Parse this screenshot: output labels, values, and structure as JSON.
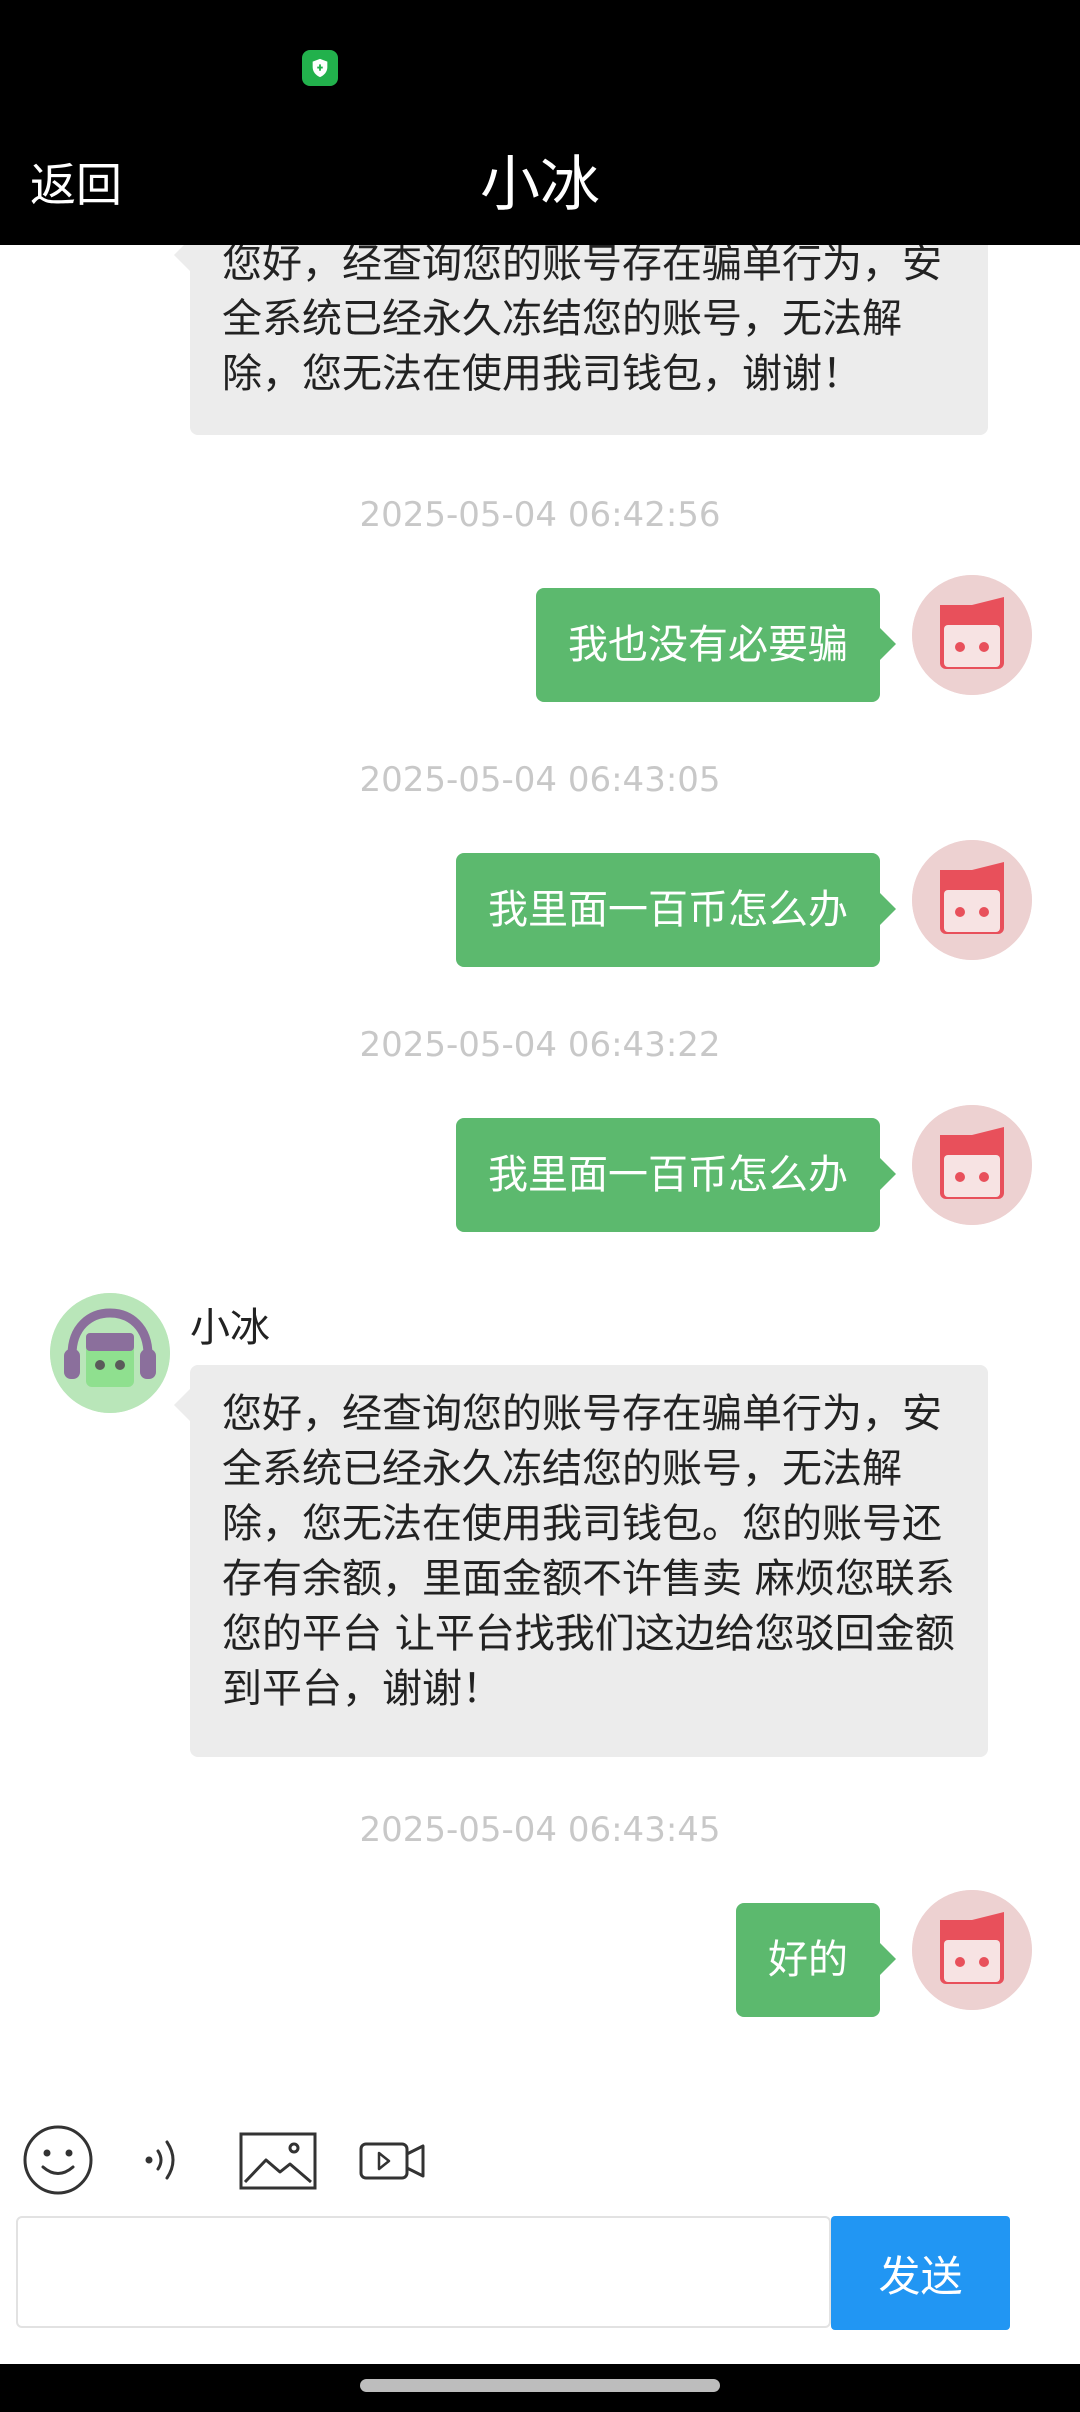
{
  "status_bar": {
    "icon": "shield-icon"
  },
  "header": {
    "back_label": "返回",
    "title": "小冰"
  },
  "messages": [
    {
      "type": "incoming",
      "text": "您好，经查询您的账号存在骗单行为，安全系统已经永久冻结您的账号，无法解除，您无法在使用我司钱包，谢谢！"
    },
    {
      "type": "timestamp",
      "text": "2025-05-04 06:42:56"
    },
    {
      "type": "outgoing",
      "text": "我也没有必要骗"
    },
    {
      "type": "timestamp",
      "text": "2025-05-04 06:43:05"
    },
    {
      "type": "outgoing",
      "text": "我里面一百币怎么办"
    },
    {
      "type": "timestamp",
      "text": "2025-05-04 06:43:22"
    },
    {
      "type": "outgoing",
      "text": "我里面一百币怎么办"
    },
    {
      "type": "incoming",
      "sender": "小冰",
      "text": "您好，经查询您的账号存在骗单行为，安全系统已经永久冻结您的账号，无法解除，您无法在使用我司钱包。您的账号还存有余额，里面金额不许售卖 麻烦您联系您的平台 让平台找我们这边给您驳回金额到平台，谢谢！"
    },
    {
      "type": "timestamp",
      "text": "2025-05-04 06:43:45"
    },
    {
      "type": "outgoing",
      "text": "好的"
    }
  ],
  "toolbar": {
    "icons": [
      "emoji-icon",
      "voice-icon",
      "image-icon",
      "video-icon"
    ]
  },
  "input": {
    "value": "",
    "placeholder": "",
    "send_label": "发送"
  },
  "colors": {
    "outgoing_bubble": "#5cb96e",
    "incoming_bubble": "#ececec",
    "send_button": "#2196f3",
    "header": "#000000"
  }
}
